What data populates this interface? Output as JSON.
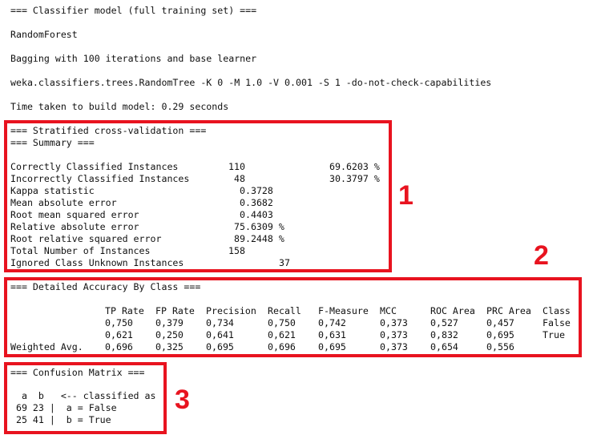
{
  "header": {
    "line1": "=== Classifier model (full training set) ===",
    "line2": "RandomForest",
    "line3": "Bagging with 100 iterations and base learner",
    "line4": "weka.classifiers.trees.RandomTree -K 0 -M 1.0 -V 0.001 -S 1 -do-not-check-capabilities",
    "line5": "Time taken to build model: 0.29 seconds"
  },
  "summary": {
    "title": "=== Stratified cross-validation ===",
    "subtitle": "=== Summary ===",
    "rows": [
      {
        "label": "Correctly Classified Instances",
        "value": "110",
        "pct": "69.6203 %"
      },
      {
        "label": "Incorrectly Classified Instances",
        "value": "48",
        "pct": "30.3797 %"
      },
      {
        "label": "Kappa statistic",
        "value": "0.3728",
        "pct": ""
      },
      {
        "label": "Mean absolute error",
        "value": "0.3682",
        "pct": ""
      },
      {
        "label": "Root mean squared error",
        "value": "0.4403",
        "pct": ""
      },
      {
        "label": "Relative absolute error",
        "value": "75.6309 %",
        "pct": ""
      },
      {
        "label": "Root relative squared error",
        "value": "89.2448 %",
        "pct": ""
      },
      {
        "label": "Total Number of Instances",
        "value": "158",
        "pct": ""
      },
      {
        "label": "Ignored Class Unknown Instances",
        "value": "37",
        "pct": ""
      }
    ]
  },
  "accuracy": {
    "title": "=== Detailed Accuracy By Class ===",
    "headers": [
      "TP Rate",
      "FP Rate",
      "Precision",
      "Recall",
      "F-Measure",
      "MCC",
      "ROC Area",
      "PRC Area",
      "Class"
    ],
    "rows": [
      {
        "label": "",
        "cells": [
          "0,750",
          "0,379",
          "0,734",
          "0,750",
          "0,742",
          "0,373",
          "0,527",
          "0,457",
          "False"
        ]
      },
      {
        "label": "",
        "cells": [
          "0,621",
          "0,250",
          "0,641",
          "0,621",
          "0,631",
          "0,373",
          "0,832",
          "0,695",
          "True"
        ]
      },
      {
        "label": "Weighted Avg.",
        "cells": [
          "0,696",
          "0,325",
          "0,695",
          "0,696",
          "0,695",
          "0,373",
          "0,654",
          "0,556",
          ""
        ]
      }
    ]
  },
  "confusion": {
    "title": "=== Confusion Matrix ===",
    "line1": "  a  b   <-- classified as",
    "line2": " 69 23 |  a = False",
    "line3": " 25 41 |  b = True"
  },
  "annotations": {
    "n1": "1",
    "n2": "2",
    "n3": "3",
    "color": "#e8131f"
  }
}
